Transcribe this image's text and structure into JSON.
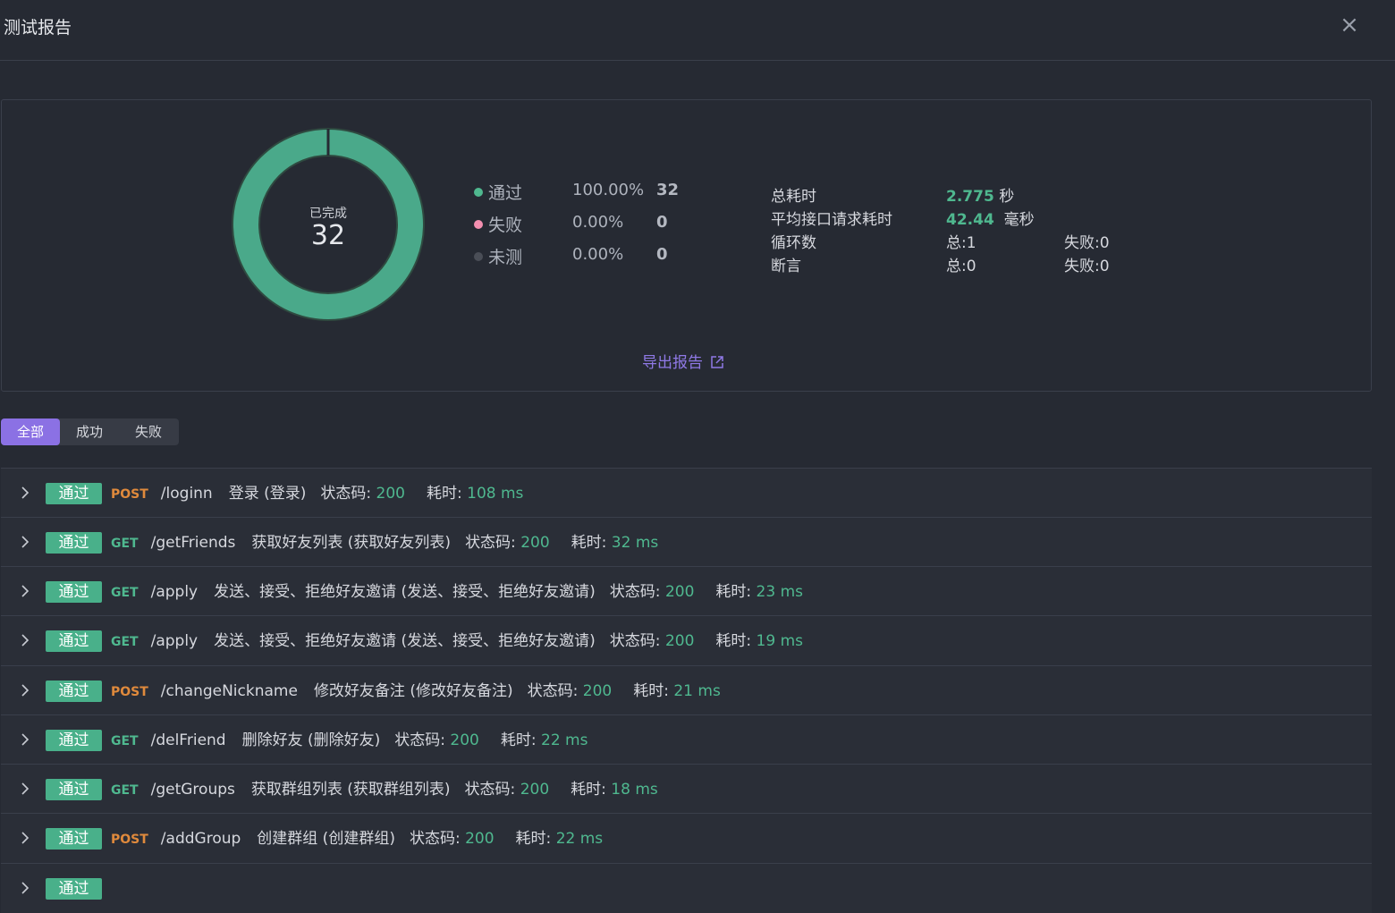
{
  "header": {
    "title": "测试报告",
    "close_icon": "close-icon"
  },
  "summary": {
    "donut": {
      "center_label": "已完成",
      "center_value": "32",
      "pass_fraction": 1.0,
      "color_pass": "#4aa98a",
      "color_fail": "#f38fb0",
      "color_untested": "#4a4e57"
    },
    "legend": [
      {
        "name": "通过",
        "percent": "100.00%",
        "count": "32",
        "color": "#4fb88f"
      },
      {
        "name": "失败",
        "percent": "0.00%",
        "count": "0",
        "color": "#f38fb0"
      },
      {
        "name": "未测",
        "percent": "0.00%",
        "count": "0",
        "color": "#4a4e57"
      }
    ],
    "stats": {
      "total_time_label": "总耗时",
      "total_time_value": "2.775",
      "total_time_unit": "秒",
      "avg_label": "平均接口请求耗时",
      "avg_value": "42.44",
      "avg_unit": "毫秒",
      "loop_label": "循环数",
      "loop_total": "总:1",
      "loop_fail": "失败:0",
      "assert_label": "断言",
      "assert_total": "总:0",
      "assert_fail": "失败:0"
    },
    "export_label": "导出报告"
  },
  "tabs": [
    {
      "label": "全部",
      "active": true
    },
    {
      "label": "成功",
      "active": false
    },
    {
      "label": "失败",
      "active": false
    }
  ],
  "list_labels": {
    "status_code": "状态码: ",
    "time": "耗时: "
  },
  "results": [
    {
      "status": "通过",
      "method": "POST",
      "path": "/loginn",
      "desc": "登录 (登录)",
      "code": "200",
      "time": "108 ms"
    },
    {
      "status": "通过",
      "method": "GET",
      "path": "/getFriends",
      "desc": "获取好友列表 (获取好友列表)",
      "code": "200",
      "time": "32 ms"
    },
    {
      "status": "通过",
      "method": "GET",
      "path": "/apply",
      "desc": "发送、接受、拒绝好友邀请 (发送、接受、拒绝好友邀请)",
      "code": "200",
      "time": "23 ms"
    },
    {
      "status": "通过",
      "method": "GET",
      "path": "/apply",
      "desc": "发送、接受、拒绝好友邀请 (发送、接受、拒绝好友邀请)",
      "code": "200",
      "time": "19 ms"
    },
    {
      "status": "通过",
      "method": "POST",
      "path": "/changeNickname",
      "desc": "修改好友备注 (修改好友备注)",
      "code": "200",
      "time": "21 ms"
    },
    {
      "status": "通过",
      "method": "GET",
      "path": "/delFriend",
      "desc": "删除好友 (删除好友)",
      "code": "200",
      "time": "22 ms"
    },
    {
      "status": "通过",
      "method": "GET",
      "path": "/getGroups",
      "desc": "获取群组列表 (获取群组列表)",
      "code": "200",
      "time": "18 ms"
    },
    {
      "status": "通过",
      "method": "POST",
      "path": "/addGroup",
      "desc": "创建群组 (创建群组)",
      "code": "200",
      "time": "22 ms"
    },
    {
      "status": "通过",
      "method": "",
      "path": "",
      "desc": "",
      "code": "",
      "time": ""
    }
  ]
}
